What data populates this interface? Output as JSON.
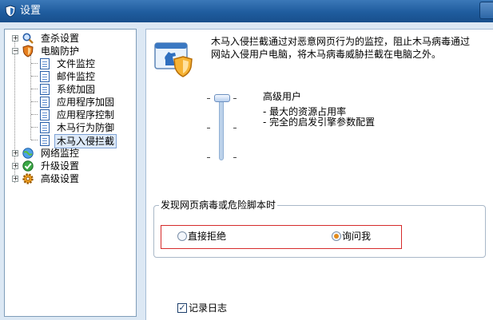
{
  "window": {
    "title": "设置"
  },
  "tree": {
    "items": [
      {
        "label": "查杀设置",
        "icon": "magnifier-icon",
        "expander": "+"
      },
      {
        "label": "电脑防护",
        "icon": "shield-icon",
        "expander": "−"
      },
      {
        "label": "文件监控",
        "icon": "document-icon"
      },
      {
        "label": "邮件监控",
        "icon": "document-icon"
      },
      {
        "label": "系统加固",
        "icon": "document-icon"
      },
      {
        "label": "应用程序加固",
        "icon": "document-icon"
      },
      {
        "label": "应用程序控制",
        "icon": "document-icon"
      },
      {
        "label": "木马行为防御",
        "icon": "document-icon"
      },
      {
        "label": "木马入侵拦截",
        "icon": "document-icon",
        "selected": true
      },
      {
        "label": "网络监控",
        "icon": "network-icon",
        "expander": "+"
      },
      {
        "label": "升级设置",
        "icon": "upgrade-icon",
        "expander": "+"
      },
      {
        "label": "高级设置",
        "icon": "gear-icon",
        "expander": "+"
      }
    ]
  },
  "content": {
    "description": "木马入侵拦截通过对恶意网页行为的监控，阻止木马病毒通过网站入侵用户电脑，将木马病毒威胁拦截在电脑之外。",
    "level": {
      "title": "高级用户",
      "lines": [
        "- 最大的资源占用率",
        "- 完全的启发引擎参数配置"
      ]
    },
    "group": {
      "legend": "发现网页病毒或危险脚本时",
      "options": [
        {
          "label": "直接拒绝",
          "checked": false
        },
        {
          "label": "询问我",
          "checked": true
        }
      ]
    },
    "log": {
      "label": "记录日志",
      "checked": true,
      "mark": "✓"
    }
  },
  "colors": {
    "titlebar": "#1f5c9e",
    "highlight": "#d62b2b",
    "radio_accent": "#e38a1a"
  }
}
